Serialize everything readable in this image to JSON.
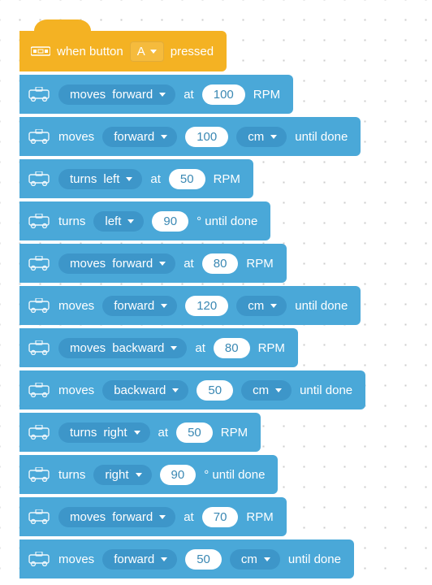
{
  "hat": {
    "prefix": "when button",
    "button": "A",
    "suffix": "pressed"
  },
  "blocks": [
    {
      "type": "moves_at",
      "direction": "forward",
      "speed": "100",
      "unit": "RPM"
    },
    {
      "type": "moves_until",
      "direction": "forward",
      "distance": "100",
      "unit": "cm",
      "suffix": "until done"
    },
    {
      "type": "turns_at",
      "direction": "left",
      "speed": "50",
      "unit": "RPM"
    },
    {
      "type": "turns_until",
      "direction": "left",
      "degrees": "90",
      "suffix": "° until done"
    },
    {
      "type": "moves_at",
      "direction": "forward",
      "speed": "80",
      "unit": "RPM"
    },
    {
      "type": "moves_until",
      "direction": "forward",
      "distance": "120",
      "unit": "cm",
      "suffix": "until done"
    },
    {
      "type": "moves_at",
      "direction": "backward",
      "speed": "80",
      "unit": "RPM"
    },
    {
      "type": "moves_until",
      "direction": "backward",
      "distance": "50",
      "unit": "cm",
      "suffix": "until done"
    },
    {
      "type": "turns_at",
      "direction": "right",
      "speed": "50",
      "unit": "RPM"
    },
    {
      "type": "turns_until",
      "direction": "right",
      "degrees": "90",
      "suffix": "° until done"
    },
    {
      "type": "moves_at",
      "direction": "forward",
      "speed": "70",
      "unit": "RPM"
    },
    {
      "type": "moves_until",
      "direction": "forward",
      "distance": "50",
      "unit": "cm",
      "suffix": "until done"
    }
  ],
  "labels": {
    "moves_at_prefix": "moves",
    "moves_until_prefix": "moves",
    "turns_at_prefix": "turns",
    "turns_until_prefix": "turns",
    "at": "at"
  }
}
